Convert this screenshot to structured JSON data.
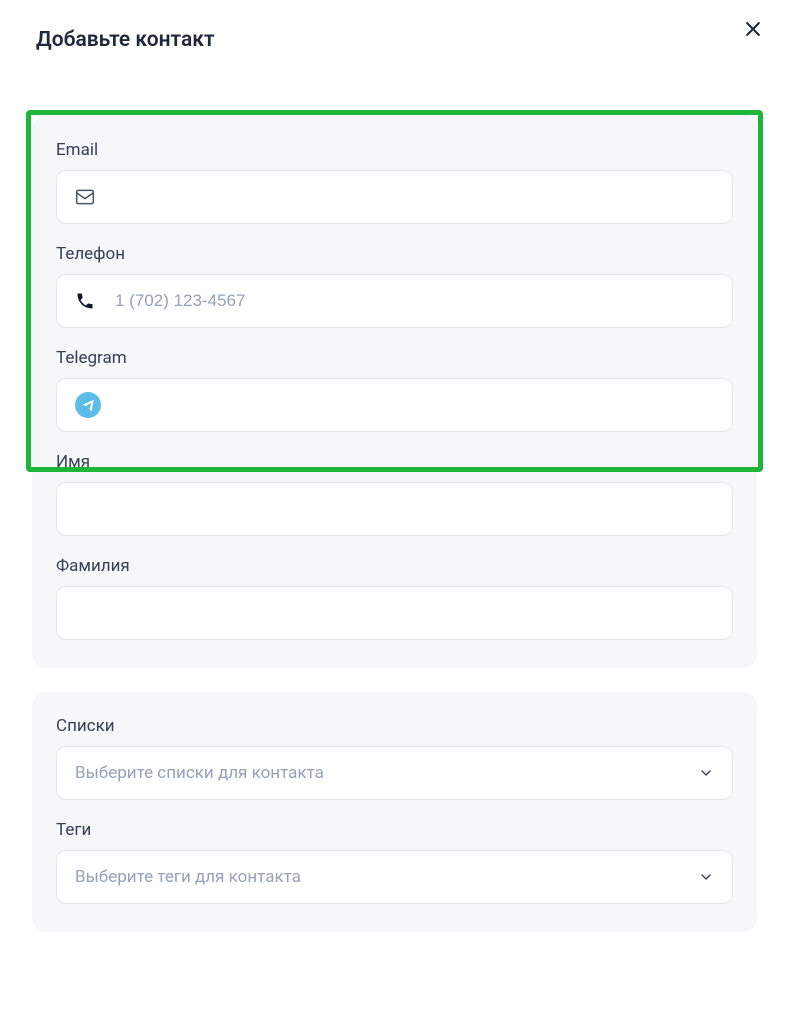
{
  "modal": {
    "title": "Добавьте контакт"
  },
  "fields": {
    "email": {
      "label": "Email",
      "placeholder": "",
      "value": ""
    },
    "phone": {
      "label": "Телефон",
      "placeholder": "1 (702) 123-4567",
      "value": ""
    },
    "telegram": {
      "label": "Telegram",
      "placeholder": "",
      "value": ""
    },
    "name": {
      "label": "Имя",
      "value": ""
    },
    "surname": {
      "label": "Фамилия",
      "value": ""
    },
    "lists": {
      "label": "Списки",
      "placeholder": "Выберите списки для контакта"
    },
    "tags": {
      "label": "Теги",
      "placeholder": "Выберите теги для контакта"
    }
  }
}
